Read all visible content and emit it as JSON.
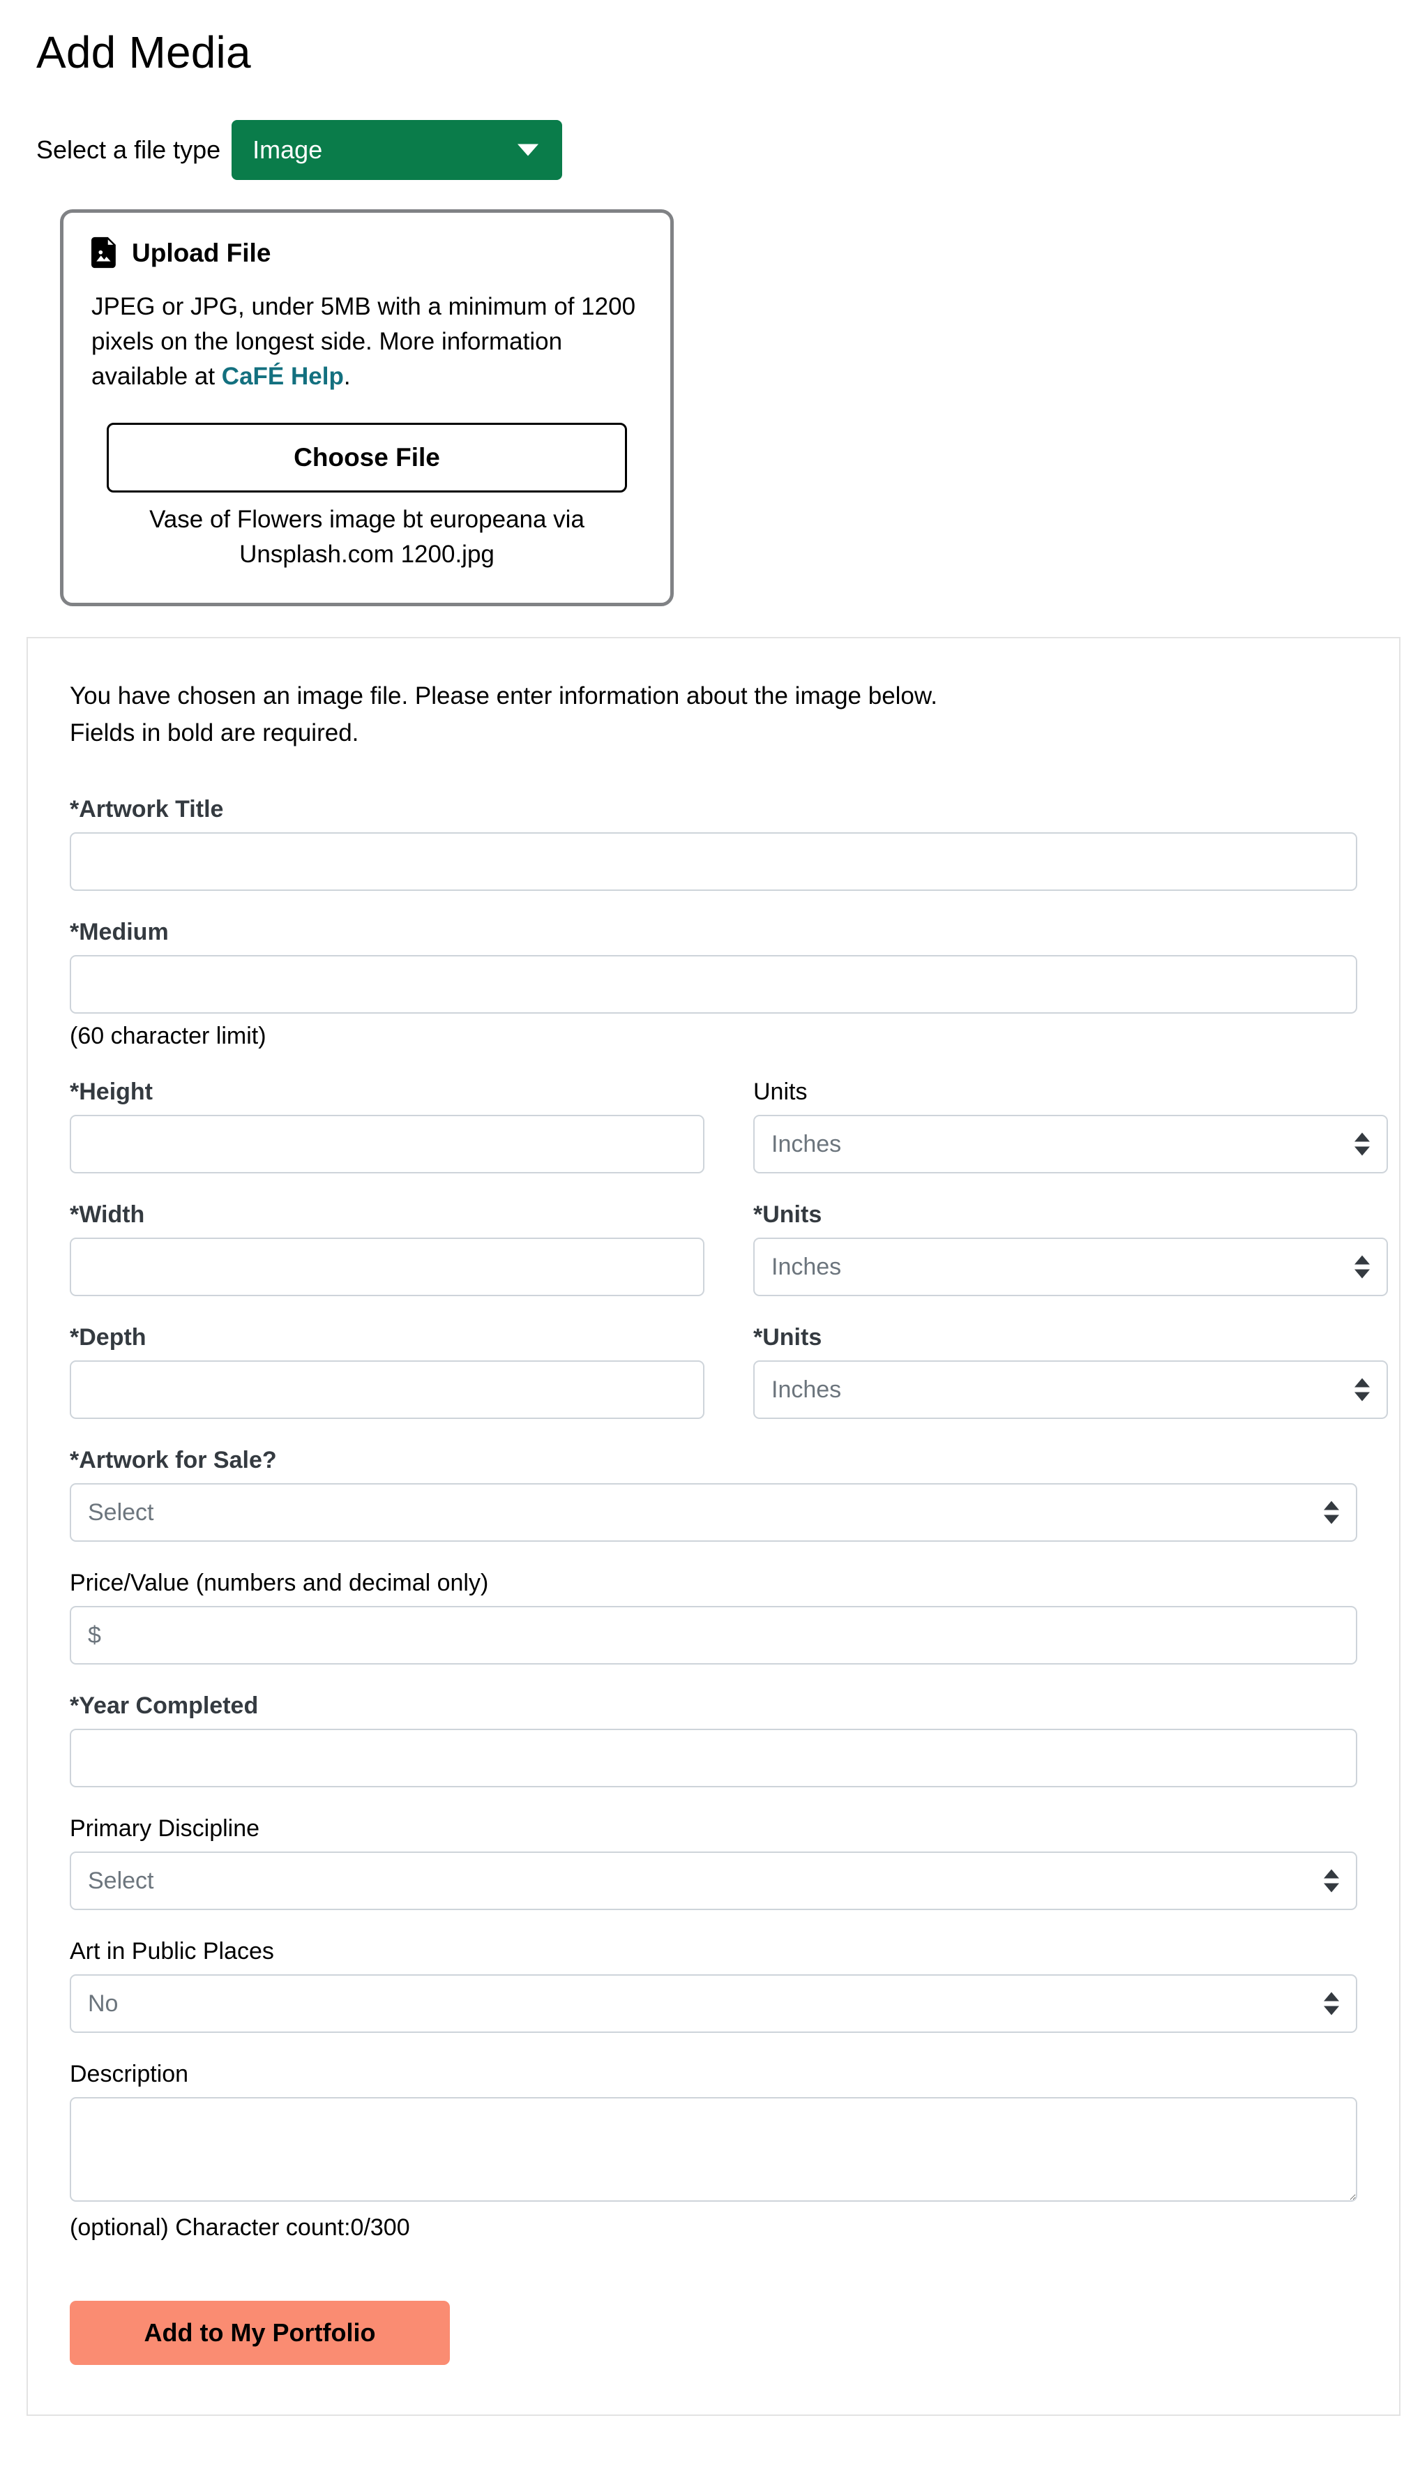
{
  "header": {
    "title": "Add Media"
  },
  "filetype": {
    "label": "Select a file type",
    "selected": "Image",
    "caret_icon": "chevron-down-icon",
    "accent_color": "#0a7c4a"
  },
  "upload": {
    "icon": "file-image-icon",
    "heading": "Upload File",
    "desc_before": "JPEG or JPG, under 5MB with a minimum of 1200 pixels on the longest side. More information available at ",
    "help_link": "CaFÉ Help",
    "help_link_color": "#13707f",
    "desc_after": ".",
    "choose_file_label": "Choose File",
    "chosen_filename": "Vase of Flowers image bt europeana via Unsplash.com 1200.jpg"
  },
  "form": {
    "intro_line1": "You have chosen an image file. Please enter information about the image below.",
    "intro_line2": "Fields in bold are required.",
    "artwork_title": {
      "label": "*Artwork Title",
      "value": "",
      "placeholder": ""
    },
    "medium": {
      "label": "*Medium",
      "value": "",
      "placeholder": "",
      "hint": "(60 character limit)"
    },
    "height": {
      "label": "*Height",
      "value": "",
      "placeholder": ""
    },
    "height_units": {
      "label": "Units",
      "selected": "Inches"
    },
    "width": {
      "label": "*Width",
      "value": "",
      "placeholder": ""
    },
    "width_units": {
      "label": "*Units",
      "selected": "Inches"
    },
    "depth": {
      "label": "*Depth",
      "value": "",
      "placeholder": ""
    },
    "depth_units": {
      "label": "*Units",
      "selected": "Inches"
    },
    "for_sale": {
      "label": "*Artwork for Sale?",
      "selected": "Select"
    },
    "price": {
      "label": "Price/Value (numbers and decimal only)",
      "value": "",
      "placeholder": "$"
    },
    "year_completed": {
      "label": "*Year Completed",
      "value": "",
      "placeholder": ""
    },
    "primary_discipline": {
      "label": "Primary Discipline",
      "selected": "Select"
    },
    "public_places": {
      "label": "Art in Public Places",
      "selected": "No"
    },
    "description": {
      "label": "Description",
      "value": "",
      "placeholder": "",
      "hint": "(optional) Character count:0/300"
    },
    "submit_label": "Add to My Portfolio",
    "submit_color": "#fa8c72"
  }
}
